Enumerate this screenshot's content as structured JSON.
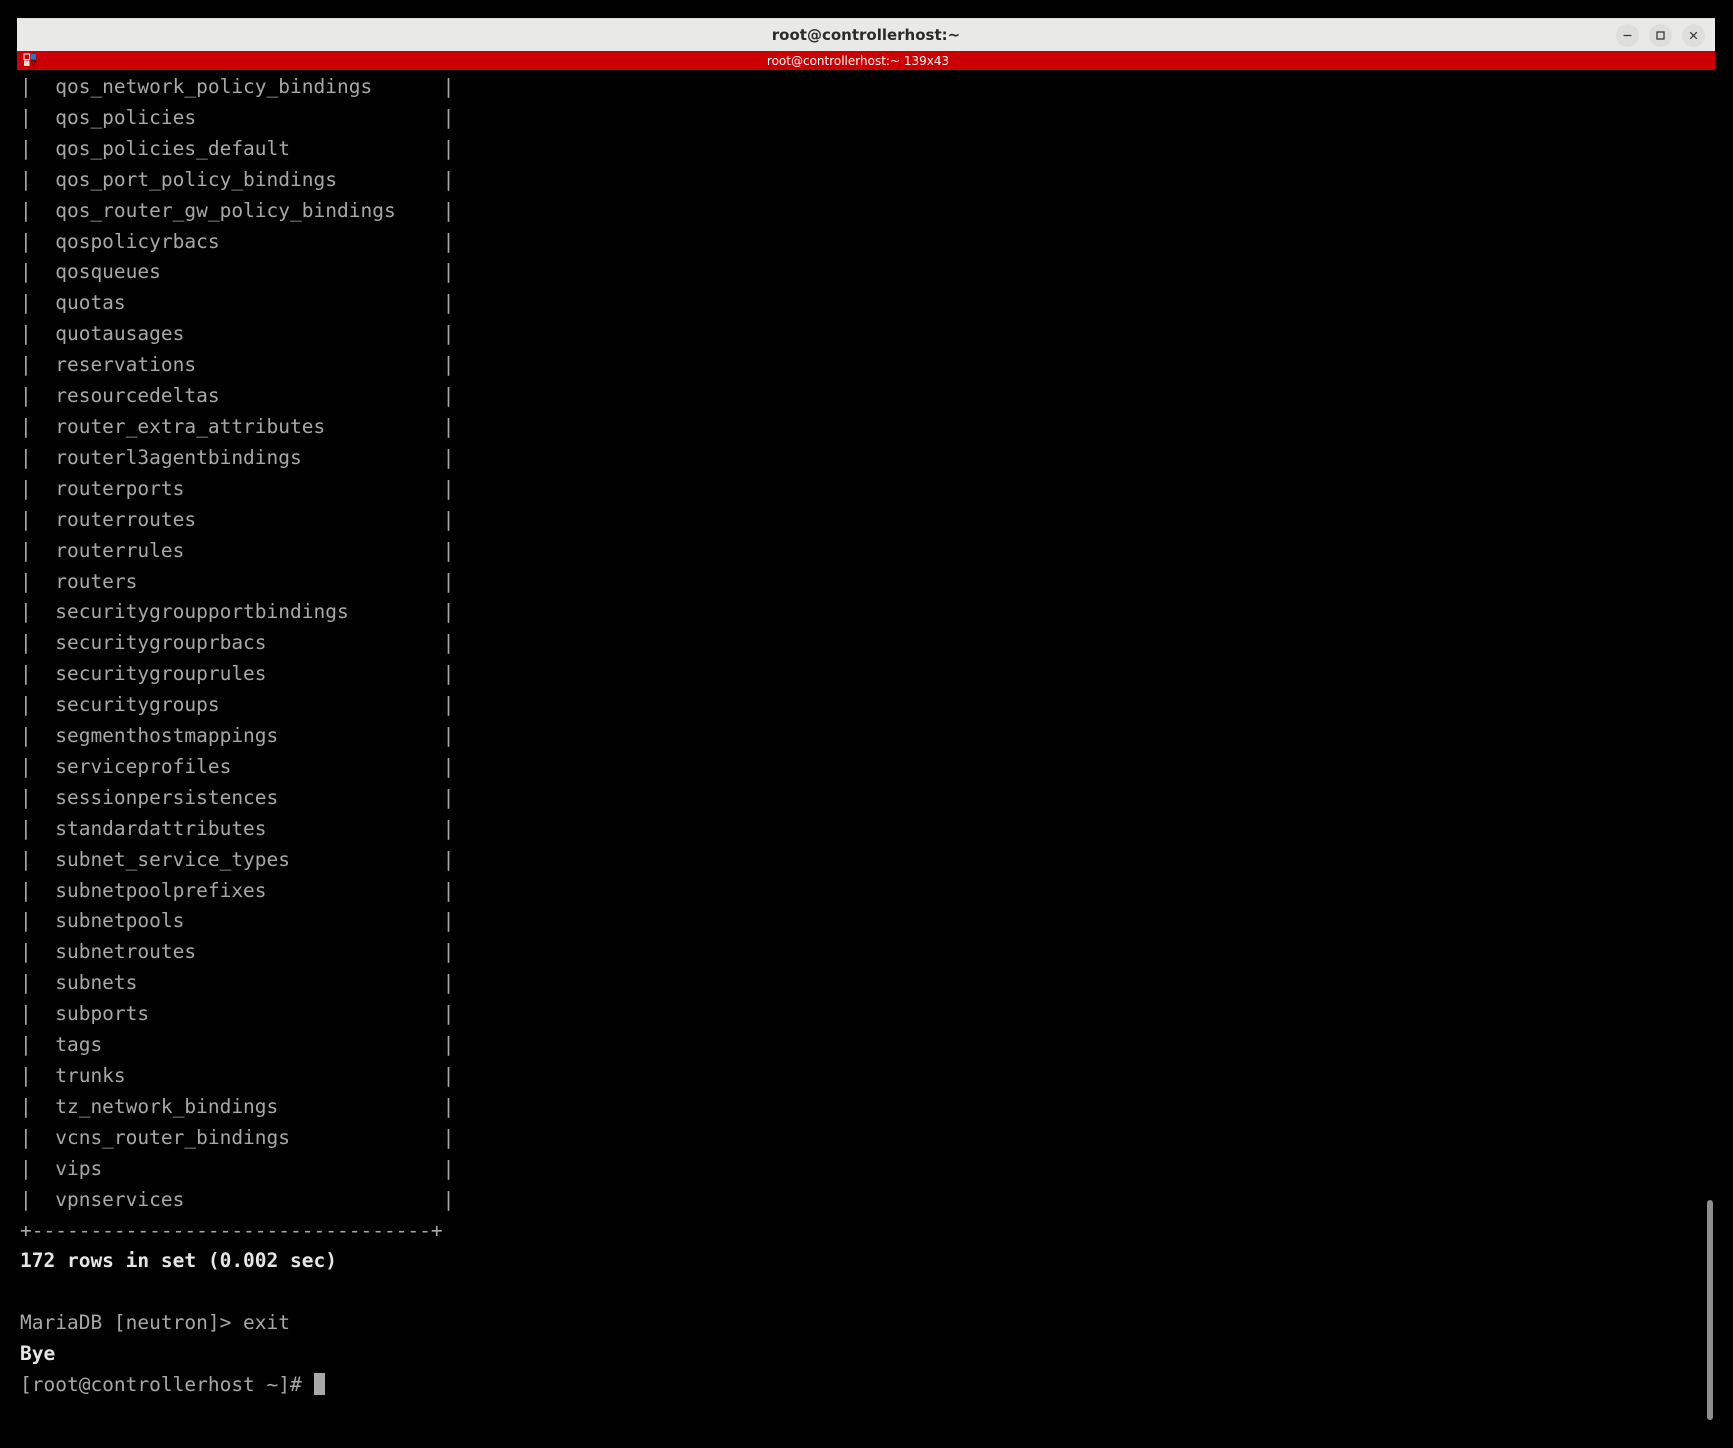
{
  "window": {
    "title": "root@controllerhost:~",
    "controls": [
      {
        "name": "minimize-button",
        "glyph": "–"
      },
      {
        "name": "maximize-button",
        "glyph": "□"
      },
      {
        "name": "close-button",
        "glyph": "×"
      }
    ]
  },
  "tab": {
    "label": "root@controllerhost:~ 139x43",
    "icon": "terminal-tab-icon",
    "bar_color": "#cc0000"
  },
  "terminal": {
    "background_color": "#000000",
    "foreground_color": "#a8a8a8",
    "bold_color": "#e6e6e6",
    "table_rows": [
      "qos_network_policy_bindings",
      "qos_policies",
      "qos_policies_default",
      "qos_port_policy_bindings",
      "qos_router_gw_policy_bindings",
      "qospolicyrbacs",
      "qosqueues",
      "quotas",
      "quotausages",
      "reservations",
      "resourcedeltas",
      "router_extra_attributes",
      "routerl3agentbindings",
      "routerports",
      "routerroutes",
      "routerrules",
      "routers",
      "securitygroupportbindings",
      "securitygrouprbacs",
      "securitygrouprules",
      "securitygroups",
      "segmenthostmappings",
      "serviceprofiles",
      "sessionpersistences",
      "standardattributes",
      "subnet_service_types",
      "subnetpoolprefixes",
      "subnetpools",
      "subnetroutes",
      "subnets",
      "subports",
      "tags",
      "trunks",
      "tz_network_bindings",
      "vcns_router_bindings",
      "vips",
      "vpnservices"
    ],
    "table_border": "+----------------------------------+",
    "row_count_line": "172 rows in set (0.002 sec)",
    "blank_line": "",
    "db_prompt": "MariaDB [neutron]> ",
    "db_command": "exit",
    "db_exit_message": "Bye",
    "shell_prompt": "[root@controllerhost ~]# "
  },
  "scrollbar": {
    "name": "vertical-scrollbar",
    "thumb_color": "#8e8e8e"
  }
}
